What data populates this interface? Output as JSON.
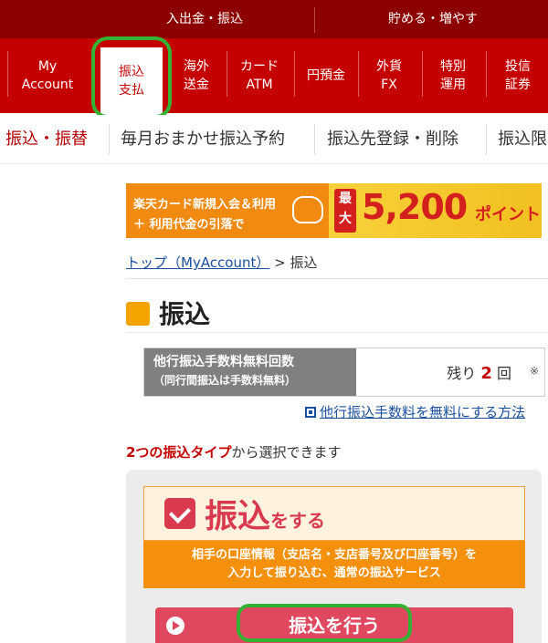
{
  "topbar": {
    "left_label": "入出金・振込",
    "right_label": "貯める・増やす"
  },
  "nav": {
    "items": [
      {
        "label": "My\nAccount"
      },
      {
        "label": "振込\n支払"
      },
      {
        "label": "海外\n送金"
      },
      {
        "label": "カード\nATM"
      },
      {
        "label": "円預金"
      },
      {
        "label": "外貨\nFX"
      },
      {
        "label": "特別\n運用"
      },
      {
        "label": "投信\n証券"
      }
    ],
    "active_index": 1
  },
  "subtabs": [
    {
      "label": "振込・振替"
    },
    {
      "label": "毎月おまかせ振込予約"
    },
    {
      "label": "振込先登録・削除"
    },
    {
      "label": "振込限"
    }
  ],
  "banner": {
    "line1": "楽天カード新規入会＆利用",
    "line2": "＋ 利用代金の引落で",
    "badge": "最大",
    "amount": "5,200",
    "unit": "ポイント"
  },
  "breadcrumb": {
    "link": "トップ（MyAccount）",
    "sep": " > ",
    "current": "振込"
  },
  "page_title": "振込",
  "fee": {
    "label1": "他行振込手数料無料回数",
    "label2": "（同行間振込は手数料無料）",
    "remaining_prefix": "残り",
    "remaining_count": "2",
    "remaining_suffix": "回",
    "note": "※"
  },
  "free_link": "他行振込手数料を無料にする方法",
  "types_intro": {
    "emphasis": "2つの振込タイプ",
    "rest": "から選択できます"
  },
  "transfer": {
    "title_big": "振込",
    "title_small": "をする",
    "desc_line1": "相手の口座情報（支店名・支店番号及び口座番号）を",
    "desc_line2": "入力して振り込む、通常の振込サービス",
    "button_label": "振込を行う"
  },
  "colors": {
    "brand_red": "#c40000",
    "dark_red": "#8c0000",
    "highlight_green": "#33b233",
    "accent_orange": "#f5900c",
    "transfer_pink": "#d93a4f"
  }
}
